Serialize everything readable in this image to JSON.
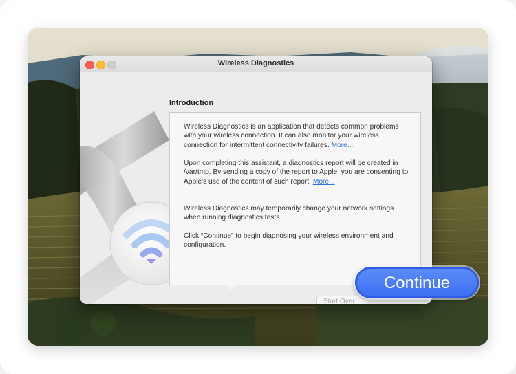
{
  "window": {
    "title": "Wireless Diagnostics"
  },
  "content": {
    "heading": "Introduction",
    "para1": "Wireless Diagnostics is an application that detects common problems with your wireless connection. It can also monitor your wireless connection for intermittent connectivity failures.",
    "para1_link": "More...",
    "para2": "Upon completing this assistant, a diagnostics report will be created in /var/tmp. By sending a copy of the report to Apple, you are consenting to Apple’s use of the content of such report.",
    "para2_link": "More...",
    "para3": "Wireless Diagnostics may temporarily change your network settings when running diagnostics tests.",
    "para4": "Click “Continue” to begin diagnosing your wireless environment and configuration."
  },
  "buttons": {
    "start_over": "Start Over",
    "continue": "Continue"
  },
  "colors": {
    "accent": "#3e6ff2",
    "link": "#2f6fd6"
  },
  "icons": [
    "close-icon",
    "minimize-icon",
    "zoom-icon",
    "wireless-diagnostics-icon",
    "wifi-icon"
  ]
}
